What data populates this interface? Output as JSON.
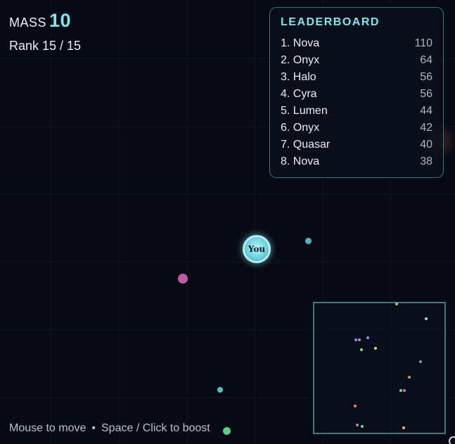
{
  "hud": {
    "mass_label": "MASS",
    "mass_value": "10",
    "rank_text": "Rank 15 / 15"
  },
  "leaderboard": {
    "title": "LEADERBOARD",
    "rows": [
      {
        "name": "1. Nova",
        "score": "110"
      },
      {
        "name": "2. Onyx",
        "score": "64"
      },
      {
        "name": "3. Halo",
        "score": "56"
      },
      {
        "name": "4. Cyra",
        "score": "56"
      },
      {
        "name": "5. Lumen",
        "score": "44"
      },
      {
        "name": "6. Onyx",
        "score": "42"
      },
      {
        "name": "7. Quasar",
        "score": "40"
      },
      {
        "name": "8. Nova",
        "score": "38"
      }
    ]
  },
  "player": {
    "label": "You",
    "color": "#6fd4df"
  },
  "hint": {
    "move": "Mouse to move",
    "separator": "•",
    "boost": "Space / Click to boost"
  },
  "colors": {
    "accent": "#7ee6f0",
    "background": "#070a14"
  }
}
